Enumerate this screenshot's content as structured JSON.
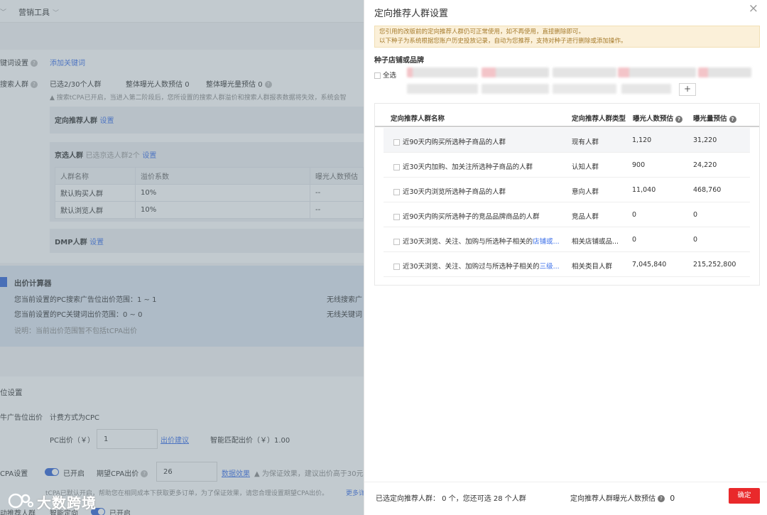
{
  "bg": {
    "topbar": {
      "menu": "营销工具"
    },
    "keyword": {
      "label": "键词设置",
      "link": "添加关键词"
    },
    "crowd": {
      "label": "搜索人群",
      "selected": "已选2/30个人群",
      "exposure_label": "整体曝光人数预估",
      "exposure_value": "0",
      "volume_label": "整体曝光量预估",
      "volume_value": "0",
      "warning": "▲ 搜索tCPA已开启，当进入第二阶段后，您所设置的搜索人群溢价和搜索人群报表数据将失效，系统会智"
    },
    "targeted": {
      "title": "定向推荐人群",
      "link": "设置"
    },
    "jd": {
      "title": "京选人群",
      "sub": "已选京选人群2个",
      "link": "设置",
      "headers": [
        "人群名称",
        "溢价系数",
        "曝光人数预估"
      ],
      "rows": [
        [
          "默认购买人群",
          "10%",
          "--"
        ],
        [
          "默认浏览人群",
          "10%",
          "--"
        ]
      ]
    },
    "dmp": {
      "title": "DMP人群",
      "link": "设置"
    },
    "calc": {
      "title": "出价计算器",
      "pc_range": "您当前设置的PC搜索广告位出价范围：1 ~ 1",
      "pc_kw_range": "您当前设置的PC关键词出价范围：0 ~ 0",
      "note": "说明：当前出价范围暂不包括tCPA出价",
      "wireless": "无线搜索广",
      "wireless_kw": "无线关键词"
    },
    "bid": {
      "title": "位设置",
      "ad_label": "牛广告位出价",
      "billing": "计费方式为CPC",
      "pc_label": "PC出价（￥）",
      "pc_value": "1",
      "pc_link": "出价建议",
      "smart_label": "智能匹配出价（￥）1.00",
      "cpa_label": "CPA设置",
      "cpa_on": "已开启",
      "cpa_expect": "期望CPA出价",
      "cpa_value": "26",
      "cpa_link": "数据效果",
      "cpa_warn": "▲ 为保证效果，建议出价高于30元",
      "tcpa_note": "tCPA已默认开启，帮助您在相同成本下获取更多订单，为了保证效果，请您合理设置期望CPA出价。",
      "more": "更多详",
      "bottom_left": "动推荐人群",
      "bottom_mid": "智能定向",
      "bottom_on": "已开启"
    },
    "watermark": "大数跨境"
  },
  "drawer": {
    "title": "定向推荐人群设置",
    "close": "×",
    "notice": [
      "您引用的改版前的定向推荐人群仍可正常使用，如不再使用，直接删除即可。",
      "以下种子为系统根据您账户历史投放记录，自动为您推荐，支持对种子进行删除或添加操作。"
    ],
    "seed_title": "种子店铺或品牌",
    "select_all": "全选",
    "plus": "+",
    "table": {
      "headers": [
        "定向推荐人群名称",
        "定向推荐人群类型",
        "曝光人数预估",
        "曝光量预估"
      ],
      "rows": [
        {
          "name": "近90天内购买所选种子商品的人群",
          "link": "",
          "type": "现有人群",
          "people": "1,120",
          "volume": "31,220"
        },
        {
          "name": "近30天内加购、加关注所选种子商品的人群",
          "link": "",
          "type": "认知人群",
          "people": "900",
          "volume": "24,220"
        },
        {
          "name": "近30天内浏览所选种子商品的人群",
          "link": "",
          "type": "意向人群",
          "people": "11,040",
          "volume": "468,760"
        },
        {
          "name": "近90天内购买所选种子的竞品品牌商品的人群",
          "link": "",
          "type": "竞品人群",
          "people": "0",
          "volume": "0"
        },
        {
          "name": "近30天浏览、关注、加购与所选种子相关的",
          "link": "店铺或...",
          "type": "相关店铺或品...",
          "people": "0",
          "volume": "0"
        },
        {
          "name": "近30天浏览、关注、加购过与所选种子相关的",
          "link": "三级...",
          "type": "相关类目人群",
          "people": "7,045,840",
          "volume": "215,252,800"
        }
      ]
    },
    "footer": {
      "selected": "已选定向推荐人群： 0 个，您还可选 28 个人群",
      "exposure_label": "定向推荐人群曝光人数预估",
      "exposure_value": "0",
      "confirm": "确定"
    }
  },
  "colors": {
    "primary_red": "#e9292b",
    "link_blue": "#3a6ee8",
    "notice_bg": "#fbf0d9"
  }
}
